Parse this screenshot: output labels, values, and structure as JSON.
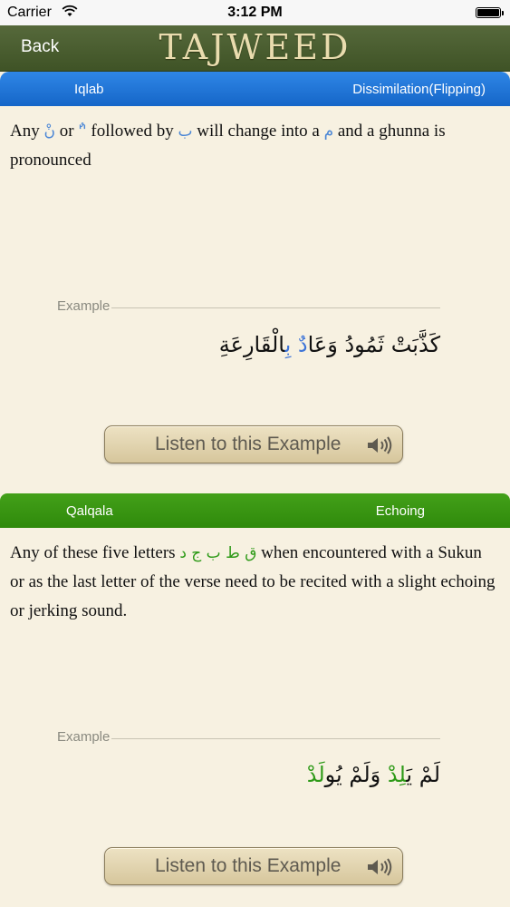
{
  "status_bar": {
    "carrier": "Carrier",
    "time": "3:12 PM"
  },
  "nav": {
    "back_label": "Back",
    "title": "TAJWEED"
  },
  "sections": [
    {
      "left_label": "Iqlab",
      "right_label": "Dissimilation(Flipping)",
      "color": "#1b6fd0",
      "desc_parts": {
        "p1": "Any ",
        "ar1": "نْ",
        "p2": " or ",
        "ar2": "'ٌ'",
        "p3": " followed by ",
        "ar3": "ب",
        "p4": " will change into a ",
        "ar4": "م",
        "p5": " and a ghunna is pronounced"
      },
      "example_label": "Example",
      "example_ar": {
        "plain": "كَذَّبَتْ ثَمُودُ وَعَا",
        "hl": "دٌ بِ",
        "tail": "الْقَارِعَةِ"
      },
      "listen_label": "Listen to this Example"
    },
    {
      "left_label": "Qalqala",
      "right_label": "Echoing",
      "color": "#36930f",
      "desc_parts": {
        "p1": "Any of these five letters ",
        "ar1": "ق ط ب ج د",
        "p2": " when encountered with a Sukun or as the last letter of the verse need to be recited with a slight echoing or jerking sound."
      },
      "example_label": "Example",
      "example_ar": {
        "p1": "لَمْ يَ",
        "hl1": "لِدْ",
        "p2": " وَلَمْ يُو",
        "hl2": "لَدْ"
      },
      "listen_label": "Listen to this Example"
    }
  ],
  "icons": {
    "wifi": "wifi-icon",
    "battery": "battery-icon",
    "speaker": "speaker-icon"
  }
}
